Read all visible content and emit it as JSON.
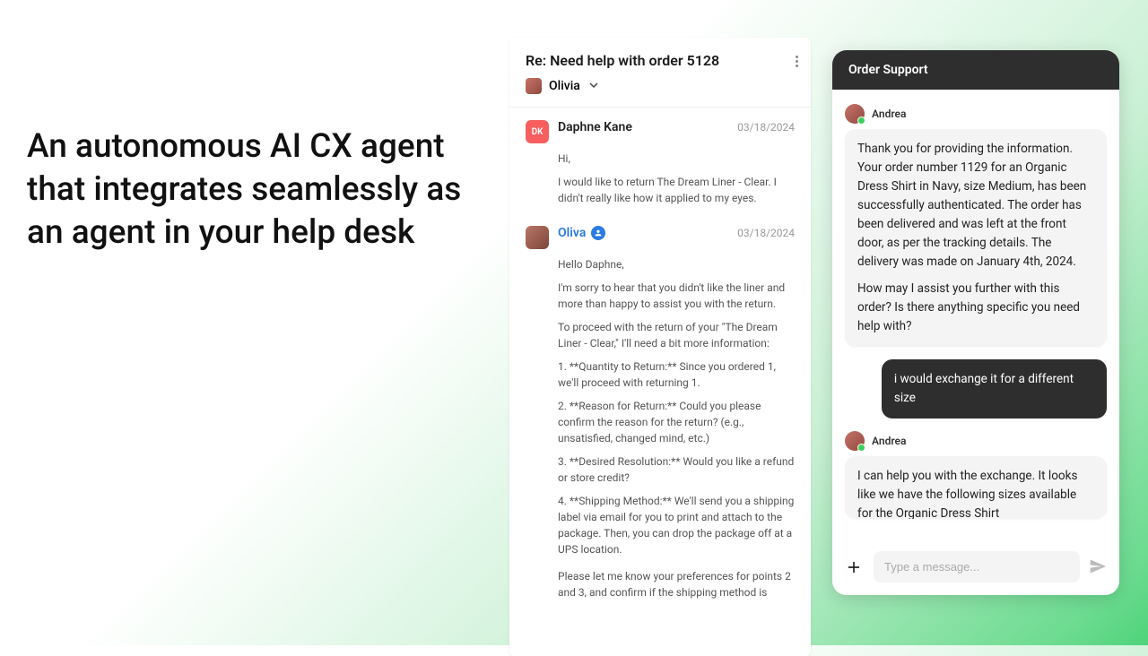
{
  "headline": "An autonomous AI CX agent that integrates seamlessly as an agent in your help desk",
  "email": {
    "subject": "Re: Need help with order 5128",
    "assignee": "Olivia",
    "messages": [
      {
        "avatar_initials": "DK",
        "name": "Daphne Kane",
        "date": "03/18/2024",
        "paragraphs": [
          "Hi,",
          "I would like to return The Dream Liner - Clear. I didn't really like how it applied to my eyes."
        ]
      },
      {
        "name": "Oliva",
        "date": "03/18/2024",
        "paragraphs": [
          "Hello Daphne,",
          "I'm sorry to hear that you didn't like the liner and more than happy to assist you with the return.",
          "To proceed with the return of your \"The Dream Liner - Clear,\" I'll need a bit more information:",
          "1. **Quantity to Return:** Since you ordered 1, we'll proceed with returning 1.",
          "2. **Reason for Return:** Could you please confirm the reason for the return? (e.g., unsatisfied, changed mind, etc.)",
          "3. **Desired Resolution:** Would you like a refund or store credit?",
          "4. **Shipping Method:** We'll send you a shipping label via email for you to print and attach to the package. Then, you can drop the package off at a UPS location.",
          "Please let me know your preferences for points 2 and 3, and confirm if the shipping method is"
        ]
      }
    ]
  },
  "chat": {
    "title": "Order Support",
    "input_placeholder": "Type a message...",
    "messages": [
      {
        "sender": "Andrea",
        "role": "agent",
        "paragraphs": [
          "Thank you for providing the information. Your order number 1129 for an Organic Dress Shirt in Navy, size Medium, has been successfully authenticated. The order has been delivered and was left at the front door, as per the tracking details. The delivery was made on January 4th, 2024.",
          "How may I assist you further with this order? Is there anything specific you need help with?"
        ]
      },
      {
        "sender": "user",
        "role": "user",
        "text": "i would exchange it for a different size"
      },
      {
        "sender": "Andrea",
        "role": "agent",
        "paragraphs": [
          "I can help you with the exchange. It looks like we have the following sizes available for the Organic Dress Shirt"
        ]
      }
    ]
  }
}
